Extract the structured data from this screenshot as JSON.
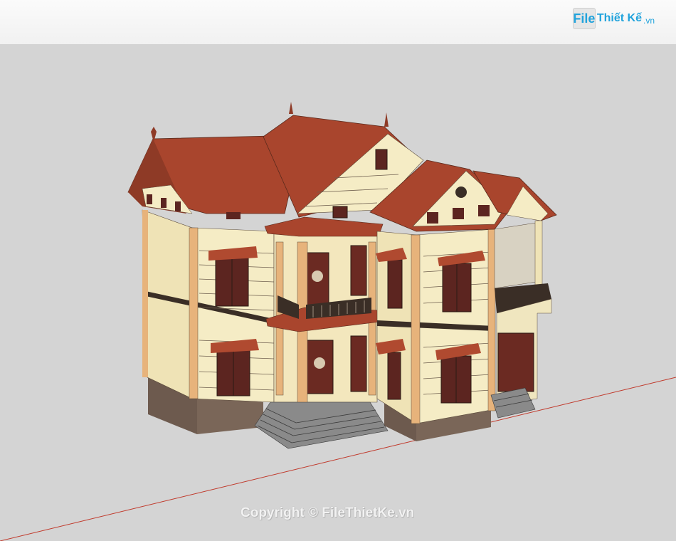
{
  "logo": {
    "file_label": "File",
    "brand_label": "Thiết Kế",
    "tld_label": ".vn"
  },
  "watermark": {
    "text": "Copyright © FileThietKe.vn"
  },
  "colors": {
    "roof": "#a9452d",
    "wall": "#f5ecc5",
    "trim": "#e7b37b",
    "base": "#6d5a4e",
    "door": "#6b2a22",
    "sky": "#f6f6f6",
    "ground": "#d4d4d4",
    "axis": "#c0392b"
  }
}
